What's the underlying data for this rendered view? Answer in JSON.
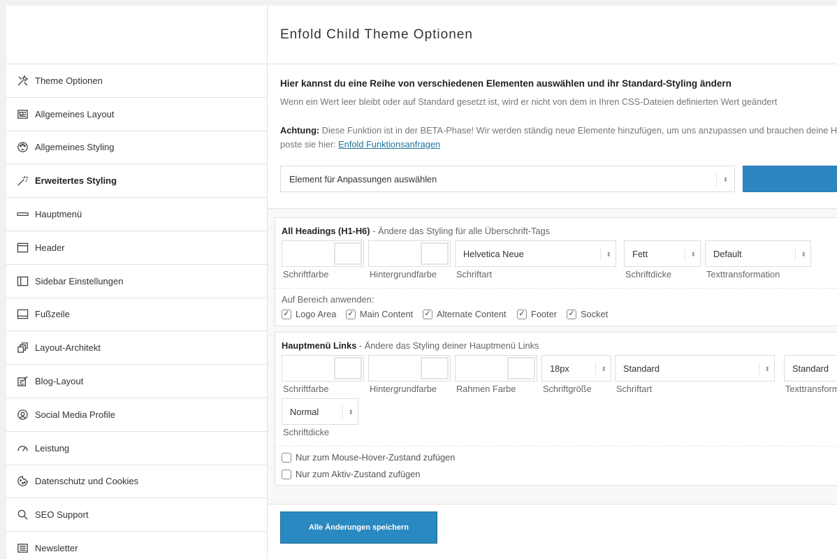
{
  "header": {
    "title": "Enfold Child Theme Optionen"
  },
  "sidebar": {
    "items": [
      {
        "label": "Theme Optionen",
        "icon": "tools-icon"
      },
      {
        "label": "Allgemeines Layout",
        "icon": "layout-icon"
      },
      {
        "label": "Allgemeines Styling",
        "icon": "palette-icon"
      },
      {
        "label": "Erweitertes Styling",
        "icon": "magic-wand-icon",
        "active": true
      },
      {
        "label": "Hauptmenü",
        "icon": "menu-bar-icon"
      },
      {
        "label": "Header",
        "icon": "header-icon"
      },
      {
        "label": "Sidebar Einstellungen",
        "icon": "sidebar-icon"
      },
      {
        "label": "Fußzeile",
        "icon": "footer-icon"
      },
      {
        "label": "Layout-Architekt",
        "icon": "layers-icon"
      },
      {
        "label": "Blog-Layout",
        "icon": "edit-icon"
      },
      {
        "label": "Social Media Profile",
        "icon": "at-icon"
      },
      {
        "label": "Leistung",
        "icon": "speedometer-icon"
      },
      {
        "label": "Datenschutz und Cookies",
        "icon": "cookie-icon"
      },
      {
        "label": "SEO Support",
        "icon": "search-icon"
      },
      {
        "label": "Newsletter",
        "icon": "newsletter-icon"
      }
    ]
  },
  "intro": {
    "title": "Hier kannst du eine Reihe von verschiedenen Elementen auswählen und ihr Standard-Styling ändern",
    "text": "Wenn ein Wert leer bleibt oder auf Standard gesetzt ist, wird er nicht von dem in Ihren CSS-Dateien definierten Wert geändert",
    "warning_label": "Achtung:",
    "warning_text": " Diese Funktion ist in der BETA-Phase! Wir werden ständig neue Elemente hinzufügen, um uns anzupassen und brauchen deine Hi",
    "warning_text2": "poste sie hier: ",
    "warning_link": "Enfold Funktionsanfragen"
  },
  "element_select": {
    "value": "Element für Anpassungen auswählen"
  },
  "panel_headings": {
    "title_bold": "All Headings (H1-H6)",
    "title_rest": " - Ändere das Styling für alle Überschrift-Tags",
    "labels": {
      "text_color": "Schriftfarbe",
      "bg_color": "Hintergrundfarbe",
      "font": "Schriftart",
      "weight": "Schriftdicke",
      "transform": "Texttransformation"
    },
    "font_value": "Helvetica Neue",
    "weight_value": "Fett",
    "transform_value": "Default",
    "apply_label": "Auf Bereich anwenden:",
    "areas": [
      {
        "label": "Logo Area",
        "checked": true
      },
      {
        "label": "Main Content",
        "checked": true
      },
      {
        "label": "Alternate Content",
        "checked": true
      },
      {
        "label": "Footer",
        "checked": true
      },
      {
        "label": "Socket",
        "checked": true
      }
    ]
  },
  "panel_menu": {
    "title_bold": "Hauptmenü Links",
    "title_rest": " - Ändere das Styling deiner Hauptmenü Links",
    "labels": {
      "text_color": "Schriftfarbe",
      "bg_color": "Hintergrundfarbe",
      "border_color": "Rahmen Farbe",
      "size": "Schriftgröße",
      "font": "Schriftart",
      "transform": "Texttransform",
      "weight": "Schriftdicke"
    },
    "size_value": "18px",
    "font_value": "Standard",
    "transform_value": "Standard",
    "weight_value": "Normal",
    "hover_label": "Nur zum Mouse-Hover-Zustand zufügen",
    "active_label": "Nur zum Aktiv-Zustand zufügen"
  },
  "save_button": {
    "label": "Alle Änderungen speichern"
  },
  "colors": {
    "accent": "#2a89c0",
    "border": "#e1e1e1"
  }
}
